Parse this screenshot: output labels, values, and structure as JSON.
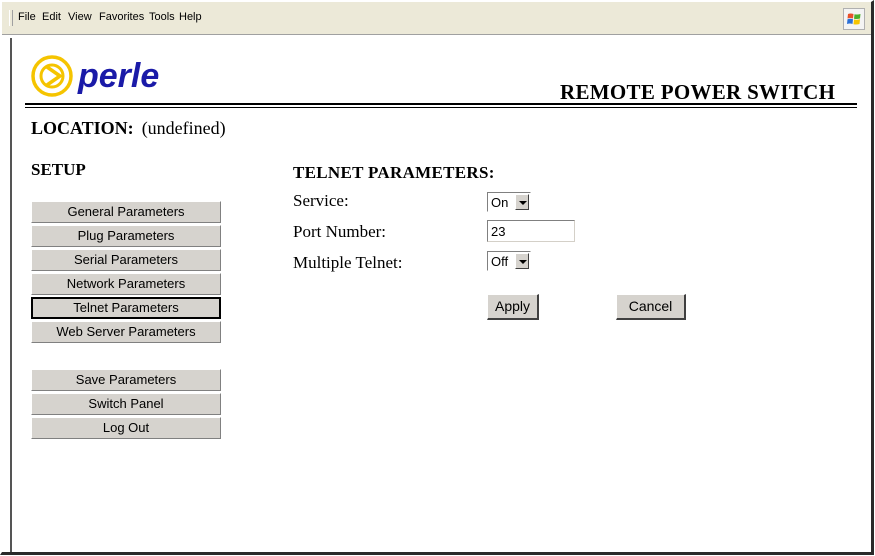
{
  "menubar": {
    "items": [
      "File",
      "Edit",
      "View",
      "Favorites",
      "Tools",
      "Help"
    ]
  },
  "header": {
    "logo_text": "perle",
    "brand_title": "REMOTE POWER SWITCH",
    "logo_color": "#1a1aa8",
    "logo_ring_color": "#f5c400"
  },
  "location": {
    "label": "LOCATION:",
    "value": "(undefined)"
  },
  "sidebar": {
    "heading": "SETUP",
    "items": [
      {
        "label": "General Parameters"
      },
      {
        "label": "Plug Parameters"
      },
      {
        "label": "Serial Parameters"
      },
      {
        "label": "Network Parameters"
      },
      {
        "label": "Telnet Parameters",
        "active": true
      },
      {
        "label": "Web Server Parameters"
      }
    ],
    "actions": [
      {
        "label": "Save Parameters"
      },
      {
        "label": "Switch Panel"
      },
      {
        "label": "Log Out"
      }
    ]
  },
  "form": {
    "heading": "TELNET PARAMETERS:",
    "service": {
      "label": "Service:",
      "value": "On"
    },
    "port_number": {
      "label": "Port Number:",
      "value": "23"
    },
    "multiple_telnet": {
      "label": "Multiple Telnet:",
      "value": "Off"
    },
    "apply_label": "Apply",
    "cancel_label": "Cancel"
  }
}
